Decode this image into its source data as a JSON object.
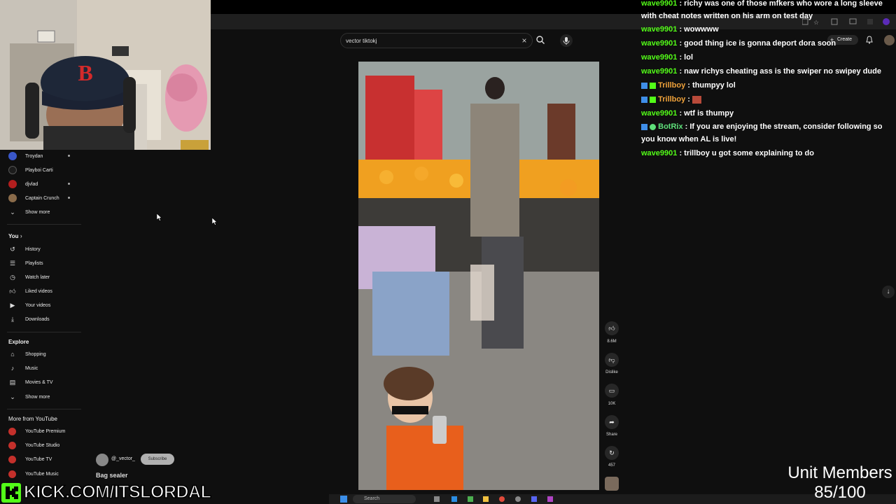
{
  "search": {
    "value": "vector tiktokj",
    "clear_icon": "×"
  },
  "topbar": {
    "create_label": "Create"
  },
  "sidebar": {
    "subs": [
      {
        "label": "Troydan",
        "color": "#3a57c9",
        "dot": true
      },
      {
        "label": "Playboi Carti",
        "color": "#1c1c1c",
        "dot": false
      },
      {
        "label": "djvlad",
        "color": "#b21e1e",
        "dot": true
      },
      {
        "label": "Captain Crunch",
        "color": "#8a6b4a",
        "dot": true
      }
    ],
    "show_more_1": "Show more",
    "you_header": "You",
    "you_chevron": "›",
    "you_items": [
      "History",
      "Playlists",
      "Watch later",
      "Liked videos",
      "Your videos",
      "Downloads"
    ],
    "explore_header": "Explore",
    "explore_items": [
      "Shopping",
      "Music",
      "Movies & TV"
    ],
    "show_more_2": "Show more",
    "more_header": "More from YouTube",
    "more_items": [
      "YouTube Premium",
      "YouTube Studio",
      "YouTube TV",
      "YouTube Music"
    ]
  },
  "video": {
    "channel": "@_vector_",
    "subscribe": "Subscribe",
    "title": "Bag sealer",
    "likes": "8.6M",
    "dislike": "Dislike",
    "comments": "10K",
    "share": "Share",
    "remix": "457"
  },
  "chat": [
    {
      "user": "wave9901",
      "color": "#53fc18",
      "text": "richy was one of those mfkers who wore a long sleeve with cheat notes written on his arm on test day",
      "badges": ""
    },
    {
      "user": "wave9901",
      "color": "#53fc18",
      "text": "wowwww",
      "badges": ""
    },
    {
      "user": "wave9901",
      "color": "#53fc18",
      "text": "good thing ice is gonna deport dora soon",
      "badges": ""
    },
    {
      "user": "wave9901",
      "color": "#53fc18",
      "text": "lol",
      "badges": ""
    },
    {
      "user": "wave9901",
      "color": "#53fc18",
      "text": "naw richys cheating ass is the swiper no swipey dude",
      "badges": ""
    },
    {
      "user": "Trillboy",
      "color": "#f0a23a",
      "text": "thumpyy lol",
      "badges": "badge"
    },
    {
      "user": "Trillboy",
      "color": "#f0a23a",
      "text": "",
      "badges": "badge",
      "emote": true
    },
    {
      "user": "wave9901",
      "color": "#53fc18",
      "text": "wtf is thumpy",
      "badges": ""
    },
    {
      "user": "BotRix",
      "color": "#5ee07a",
      "text": "If you are enjoying the stream, consider following so you know when AL is live!",
      "badges": "bot"
    },
    {
      "user": "wave9901",
      "color": "#53fc18",
      "text": "trillboy u got some explaining to do",
      "badges": ""
    }
  ],
  "overlay": {
    "unit_title": "Unit Members",
    "unit_count": "85/100",
    "kick_text": "KICK.COM/ITSLORDAL"
  },
  "taskbar": {
    "search_label": "Search"
  }
}
